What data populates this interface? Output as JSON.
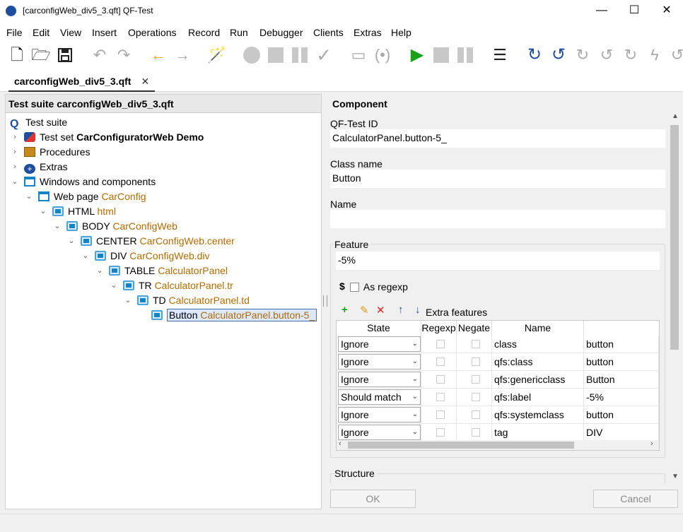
{
  "window": {
    "title": "[carconfigWeb_div5_3.qft] QF-Test",
    "minimize": "—",
    "maximize": "☐",
    "close": "✕"
  },
  "menu": [
    "File",
    "Edit",
    "View",
    "Insert",
    "Operations",
    "Record",
    "Run",
    "Debugger",
    "Clients",
    "Extras",
    "Help"
  ],
  "tab": {
    "label": "carconfigWeb_div5_3.qft",
    "close": "✕"
  },
  "tree": {
    "header": "Test suite carconfigWeb_div5_3.qft",
    "root": "Test suite",
    "testset_prefix": "Test set ",
    "testset_name": "CarConfiguratorWeb Demo",
    "procedures": "Procedures",
    "extras": "Extras",
    "windows": "Windows and components",
    "nodes": [
      {
        "tag": "Web page",
        "id": "CarConfig"
      },
      {
        "tag": "HTML",
        "id": "html"
      },
      {
        "tag": "BODY",
        "id": "CarConfigWeb"
      },
      {
        "tag": "CENTER",
        "id": "CarConfigWeb.center"
      },
      {
        "tag": "DIV",
        "id": "CarConfigWeb.div"
      },
      {
        "tag": "TABLE",
        "id": "CalculatorPanel"
      },
      {
        "tag": "TR",
        "id": "CalculatorPanel.tr"
      },
      {
        "tag": "TD",
        "id": "CalculatorPanel.td"
      },
      {
        "tag": "Button",
        "id": "CalculatorPanel.button-5_"
      }
    ]
  },
  "detail": {
    "title": "Component",
    "qftest_id_label": "QF-Test ID",
    "qftest_id": "CalculatorPanel.button-5_",
    "class_label": "Class name",
    "class_value": "Button",
    "name_label": "Name",
    "name_value": "",
    "feature_label": "Feature",
    "feature_value": "-5%",
    "regex_symbol": "$",
    "regex_label": "As regexp",
    "extra_label": "Extra features",
    "columns": [
      "State",
      "Regexp",
      "Negate",
      "Name",
      ""
    ],
    "rows": [
      {
        "state": "Ignore",
        "name": "class",
        "value": "button"
      },
      {
        "state": "Ignore",
        "name": "qfs:class",
        "value": "button"
      },
      {
        "state": "Ignore",
        "name": "qfs:genericclass",
        "value": "Button"
      },
      {
        "state": "Should match",
        "name": "qfs:label",
        "value": "-5%"
      },
      {
        "state": "Ignore",
        "name": "qfs:systemclass",
        "value": "button"
      },
      {
        "state": "Ignore",
        "name": "tag",
        "value": "DIV"
      }
    ],
    "structure_label": "Structure",
    "ok": "OK",
    "cancel": "Cancel"
  }
}
